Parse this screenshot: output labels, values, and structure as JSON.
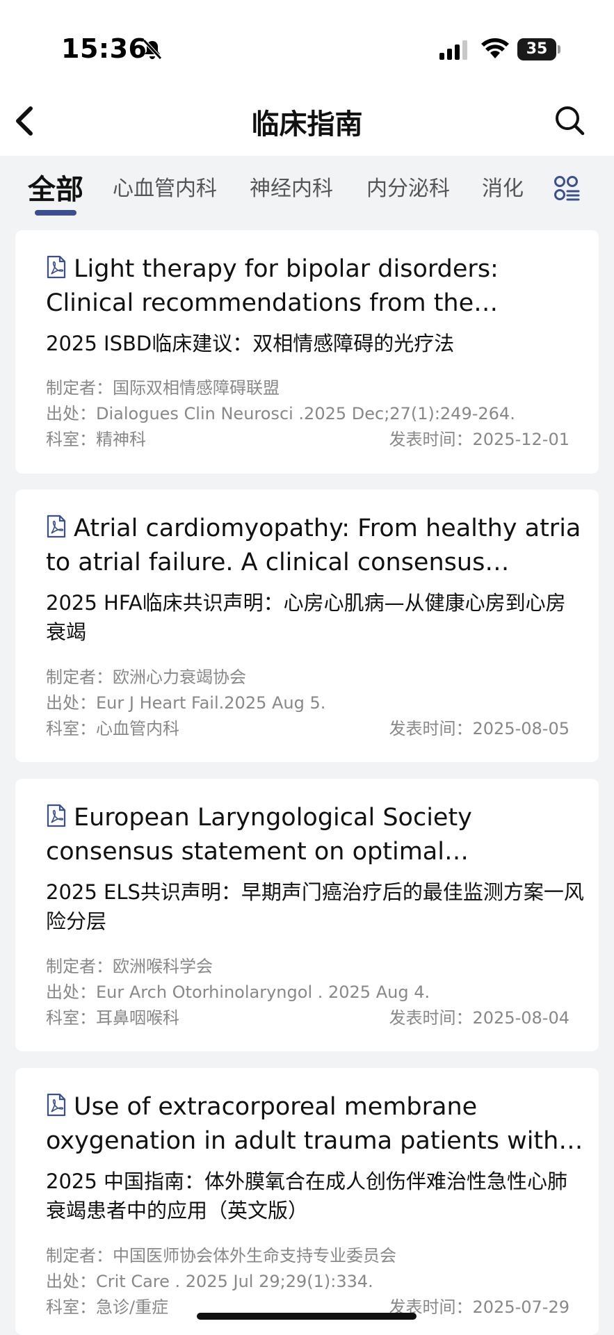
{
  "status": {
    "time": "15:36",
    "battery": "35"
  },
  "header": {
    "title": "临床指南"
  },
  "tabs": [
    {
      "label": "全部"
    },
    {
      "label": "心血管内科"
    },
    {
      "label": "神经内科"
    },
    {
      "label": "内分泌科"
    },
    {
      "label": "消化"
    }
  ],
  "cards": [
    {
      "title": "Light therapy for bipolar disorders: Clinical recommendations from the international so...",
      "subtitle": "2025 ISBD临床建议：双相情感障碍的光疗法",
      "maker": "制定者：国际双相情感障碍联盟",
      "source": "出处：Dialogues Clin Neurosci .2025 Dec;27(1):249-264.",
      "dept": "科室：精神科",
      "date": "发表时间：2025-12-01"
    },
    {
      "title": "Atrial cardiomyopathy: From healthy atria to atrial failure. A clinical consensus statem...",
      "subtitle": "2025 HFA临床共识声明：心房心肌病—从健康心房到心房衰竭",
      "maker": "制定者：欧洲心力衰竭协会",
      "source": "出处：Eur J Heart Fail.2025 Aug 5.",
      "dept": "科室：心血管内科",
      "date": "发表时间：2025-08-05"
    },
    {
      "title": "European Laryngological Society consensus statement on optimal monitorin...",
      "subtitle": "2025 ELS共识声明：早期声门癌治疗后的最佳监测方案一风险分层",
      "maker": "制定者：欧洲喉科学会",
      "source": "出处：Eur Arch Otorhinolaryngol . 2025 Aug 4.",
      "dept": "科室：耳鼻咽喉科",
      "date": "发表时间：2025-08-04"
    },
    {
      "title": "Use of extracorporeal membrane oxygenation in adult trauma patients with r...",
      "subtitle": "2025 中国指南：体外膜氧合在成人创伤伴难治性急性心肺衰竭患者中的应用（英文版）",
      "maker": "制定者：中国医师协会体外生命支持专业委员会",
      "source": "出处：Crit Care . 2025 Jul 29;29(1):334.",
      "dept": "科室：急诊/重症",
      "date": "发表时间：2025-07-29"
    }
  ],
  "icons": {
    "back": "chevron-left-icon",
    "search": "search-icon",
    "grid": "category-grid-icon",
    "pdf": "pdf-file-icon",
    "mute": "bell-slash-icon"
  },
  "colors": {
    "accent": "#3a4f8f",
    "background": "#f2f3f5",
    "meta_text": "#888888"
  }
}
